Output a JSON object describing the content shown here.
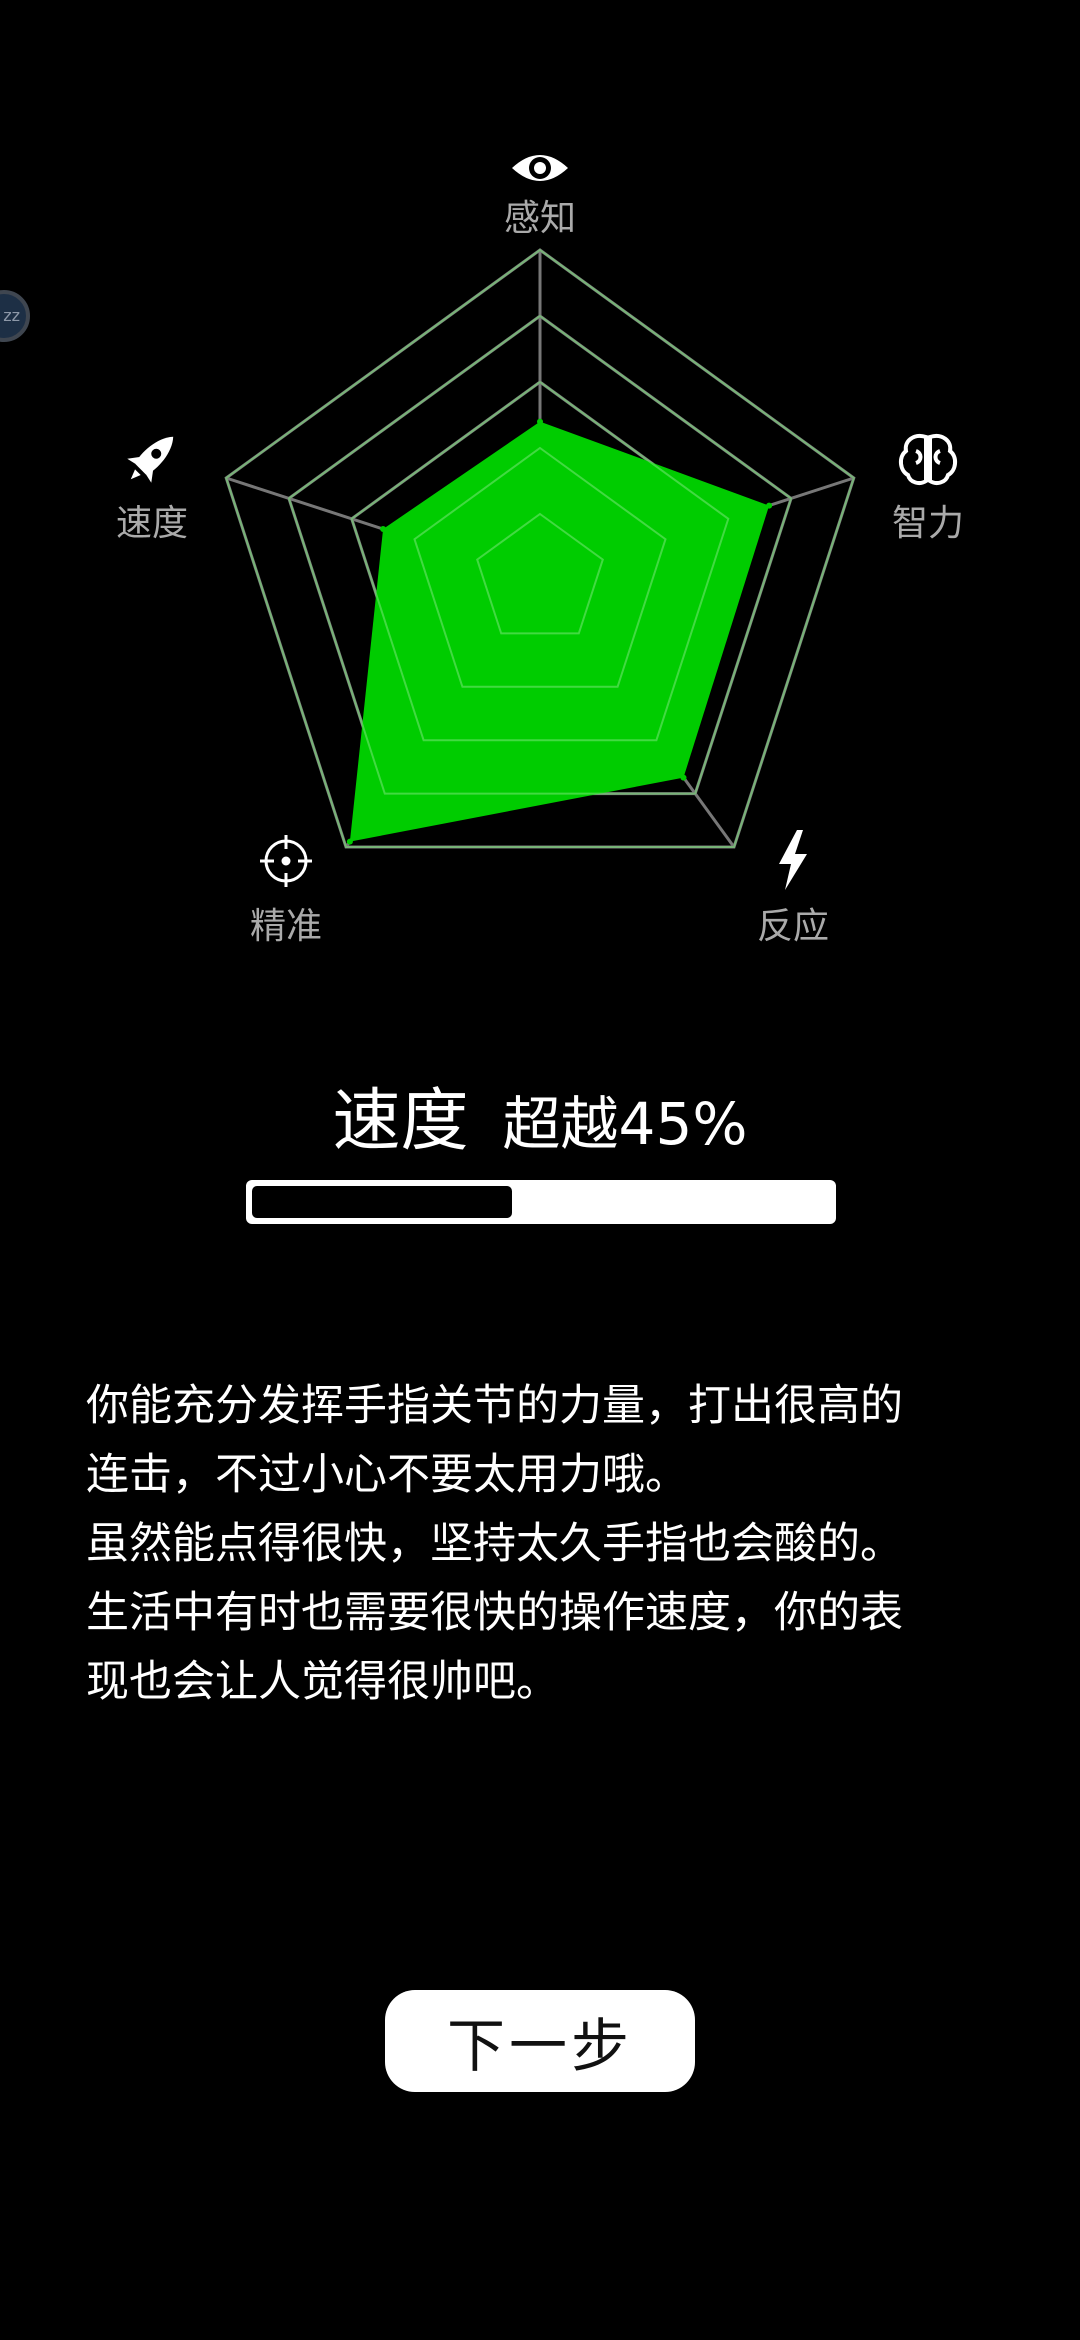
{
  "colors": {
    "background": "#000000",
    "radar_fill": "#00cc00",
    "radar_grid": "#777777",
    "label_text": "#aaaaaa",
    "icon": "#ffffff"
  },
  "chart_data": {
    "type": "radar",
    "categories": [
      "感知",
      "智力",
      "反应",
      "精准",
      "速度"
    ],
    "category_icons": [
      "eye-icon",
      "brain-icon",
      "lightning-icon",
      "crosshair-icon",
      "rocket-icon"
    ],
    "range": [
      0,
      5
    ],
    "grid_levels": 5,
    "values": [
      2.4,
      3.65,
      3.7,
      4.9,
      2.5
    ]
  },
  "radar_labels": {
    "perception": "感知",
    "intelligence": "智力",
    "reaction": "反应",
    "precision": "精准",
    "speed": "速度"
  },
  "badge": {
    "text": "zz"
  },
  "result": {
    "stat_name": "速度",
    "rank_text": "超越45%",
    "progress_percent": 45
  },
  "description": {
    "lines": [
      "你能充分发挥手指关节的力量，打出很高的",
      "连击，不过小心不要太用力哦。",
      "虽然能点得很快，坚持太久手指也会酸的。",
      "生活中有时也需要很快的操作速度，你的表",
      "现也会让人觉得很帅吧。"
    ]
  },
  "actions": {
    "next_label": "下一步"
  }
}
